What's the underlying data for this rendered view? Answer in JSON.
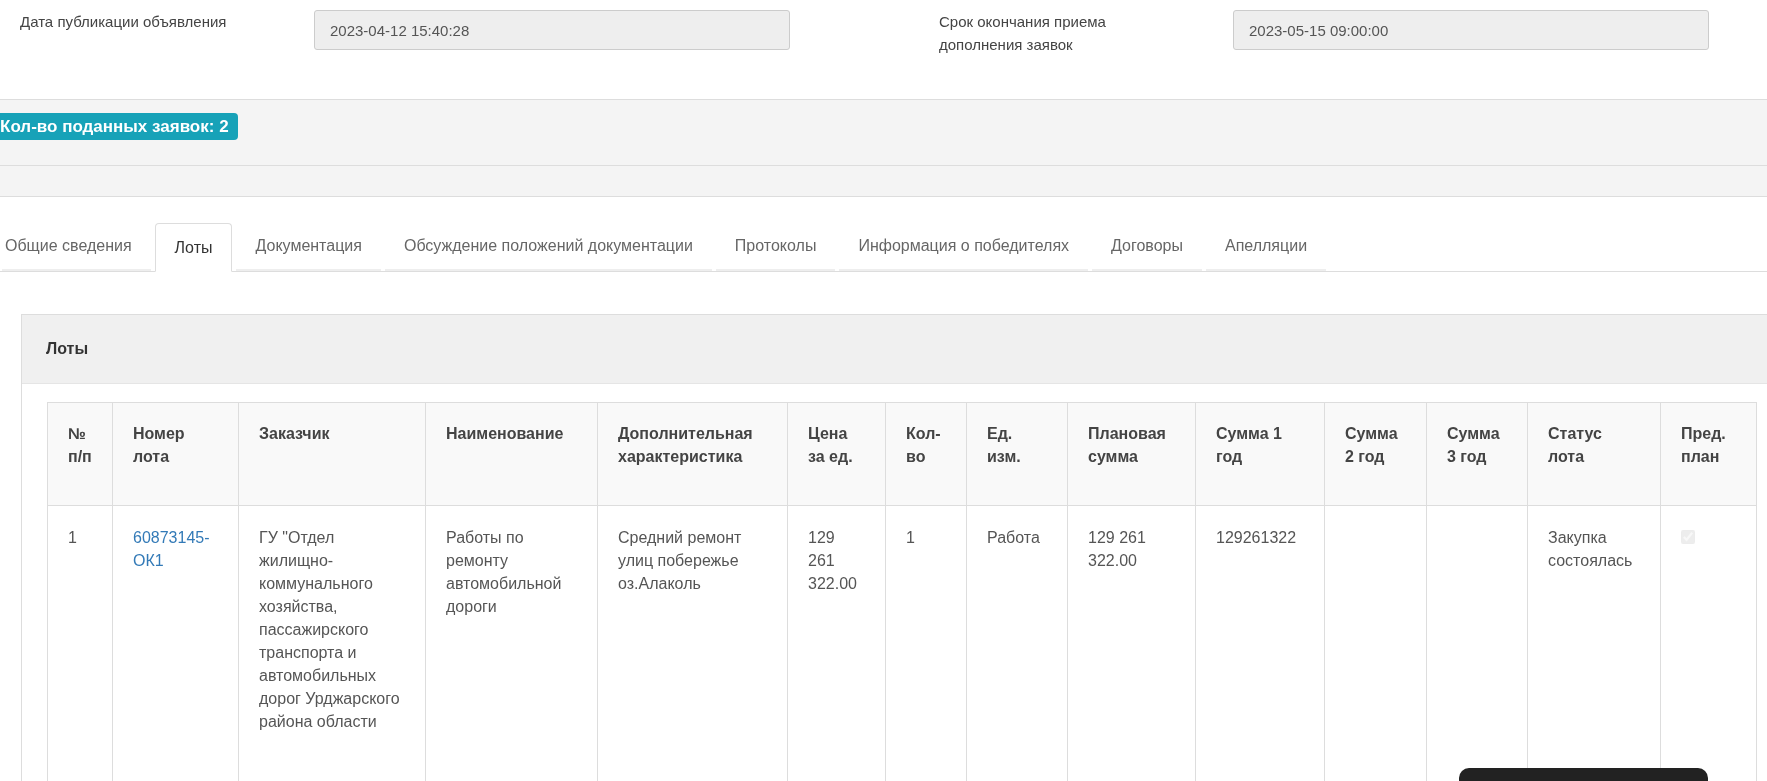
{
  "header_fields": [
    {
      "label": "Дата публикации объявления",
      "value": "2023-04-12 15:40:28"
    },
    {
      "label": "Срок окончания приема дополнения заявок",
      "value": "2023-05-15 09:00:00"
    }
  ],
  "applications_badge": "Кол-во поданных заявок: 2",
  "tabs": [
    {
      "label": "Общие сведения",
      "selected": false
    },
    {
      "label": "Лоты",
      "selected": true
    },
    {
      "label": "Документация",
      "selected": false
    },
    {
      "label": "Обсуждение положений документации",
      "selected": false
    },
    {
      "label": "Протоколы",
      "selected": false
    },
    {
      "label": "Информация о победителях",
      "selected": false
    },
    {
      "label": "Договоры",
      "selected": false
    },
    {
      "label": "Апелляции",
      "selected": false
    }
  ],
  "lots_panel": {
    "title": "Лоты",
    "table": {
      "columns": [
        "№ п/п",
        "Номер лота",
        "Заказчик",
        "Наименование",
        "Дополнительная характеристика",
        "Цена за ед.",
        "Кол-во",
        "Ед. изм.",
        "Плановая сумма",
        "Сумма 1 год",
        "Сумма 2 год",
        "Сумма 3 год",
        "Статус лота",
        "Пред. план"
      ],
      "rows": [
        {
          "number": "1",
          "lot_number": "60873145-ОК1",
          "customer": "ГУ \"Отдел жилищно-коммунального хозяйства, пассажирского транспорта и автомобильных дорог Урджарского района области",
          "name": "Работы по ремонту автомобильной дороги",
          "extra": "Средний ремонт улиц побережье оз.Алаколь",
          "unit_price": "129 261 322.00",
          "quantity": "1",
          "unit": "Работа",
          "planned_sum": "129 261 322.00",
          "sum_year_1": "129261322",
          "status": "Закупка состоялась",
          "pre_plan": {
            "checked": true,
            "disabled": true
          }
        }
      ]
    }
  }
}
